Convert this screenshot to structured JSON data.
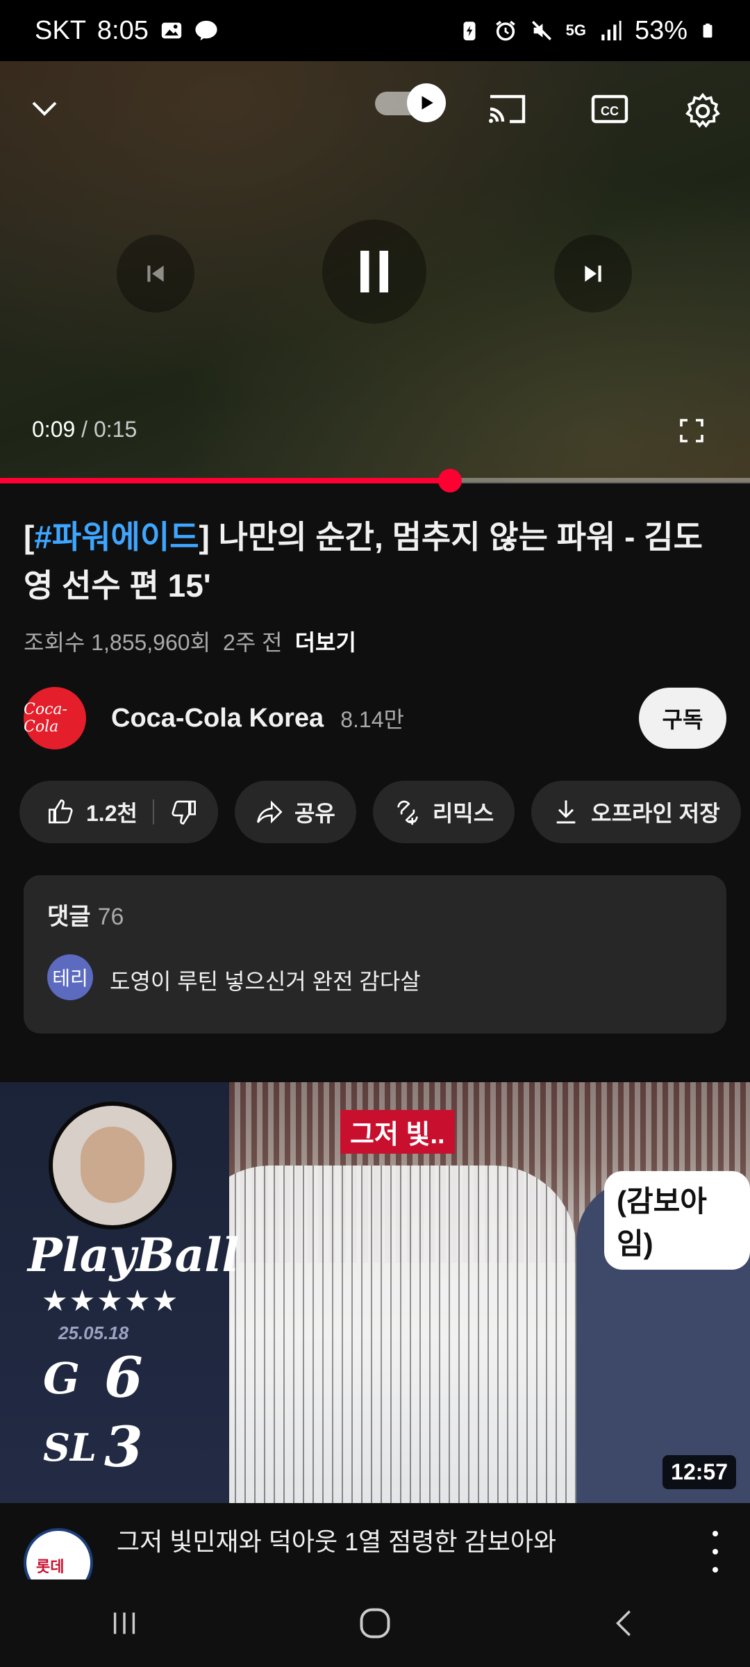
{
  "status_bar": {
    "carrier": "SKT",
    "time": "8:05",
    "battery": "53%",
    "network": "5G"
  },
  "player": {
    "time_current": "0:09",
    "time_total": "0:15",
    "time_separator": "/",
    "progress_fraction": 0.6,
    "autoplay_on": true
  },
  "video": {
    "title_tag": "#파워에이드",
    "title_rest": " 나만의 순간, 멈추지 않는 파워 - 김도영 선수 편 15'",
    "views": "조회수 1,855,960회",
    "age": "2주 전",
    "more_label": "더보기"
  },
  "channel": {
    "avatar_text": "Coca-Cola",
    "name": "Coca-Cola Korea",
    "subscribers": "8.14만",
    "subscribe_label": "구독"
  },
  "actions": {
    "likes": "1.2천",
    "share": "공유",
    "remix": "리믹스",
    "download": "오프라인 저장"
  },
  "comments": {
    "header": "댓글",
    "count": "76",
    "top_author_initials": "테리",
    "top_comment": "도영이 루틴 넣으신거 완전 감다살"
  },
  "next_video": {
    "thumb_stars": "★★★★★",
    "thumb_date": "25.05.18",
    "thumb_team1": "G",
    "thumb_score1": "6",
    "thumb_team2": "SL",
    "thumb_score2": "3",
    "thumb_logo": "PlayBall",
    "thumb_bubble1": "그저 빛..",
    "thumb_bubble2": "(감보아임)",
    "duration": "12:57",
    "channel_avatar_text": "롯데",
    "title": "그저 빛민재와 덕아웃 1열 점령한 감보아와"
  },
  "colors": {
    "accent_red": "#ff0033",
    "link_blue": "#3ea6ff",
    "chip_bg": "#272727",
    "bg": "#0f0f0f"
  }
}
